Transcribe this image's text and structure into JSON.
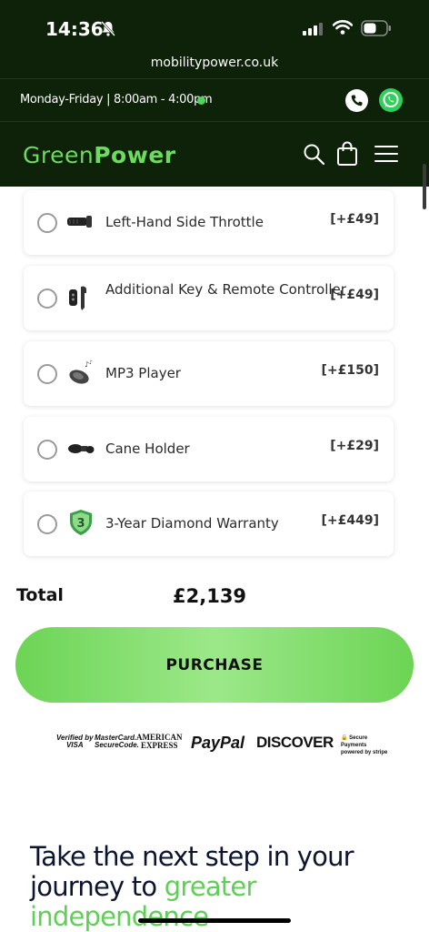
{
  "status_bar": {
    "time": "14:36"
  },
  "browser": {
    "url": "mobilitypower.co.uk"
  },
  "top_bar": {
    "hours": "Monday-Friday | 8:00am - 4:00pm"
  },
  "header": {
    "logo_part1": "Green",
    "logo_part2": "Power"
  },
  "addons": [
    {
      "label": "Left-Hand Side Throttle",
      "price": "[+£49]",
      "icon": "throttle-icon"
    },
    {
      "label": "Additional Key & Remote Controller",
      "price": "[+£49]",
      "icon": "key-remote-icon"
    },
    {
      "label": "MP3 Player",
      "price": "[+£150]",
      "icon": "mp3-player-icon"
    },
    {
      "label": "Cane Holder",
      "price": "[+£29]",
      "icon": "cane-holder-icon"
    },
    {
      "label": "3-Year Diamond Warranty",
      "price": "[+£449]",
      "icon": "warranty-shield-icon"
    }
  ],
  "total": {
    "label": "Total",
    "value": "£2,139"
  },
  "purchase_button": {
    "label": "PURCHASE"
  },
  "payment_methods": {
    "visa": "Verified by VISA",
    "mastercard": "MasterCard. SecureCode.",
    "amex": "AMERICAN EXPRESS",
    "paypal": "PayPal",
    "discover": "DISCOVER",
    "stripe": "Secure Payments powered by stripe"
  },
  "promo": {
    "line1": "Take the next step in your",
    "line2a": "journey to ",
    "line2b": "greater",
    "line3": "independence"
  },
  "colors": {
    "brand_green": "#6ddb5e",
    "header_bg": "#0d2208",
    "button_green": "#8fe07a"
  }
}
